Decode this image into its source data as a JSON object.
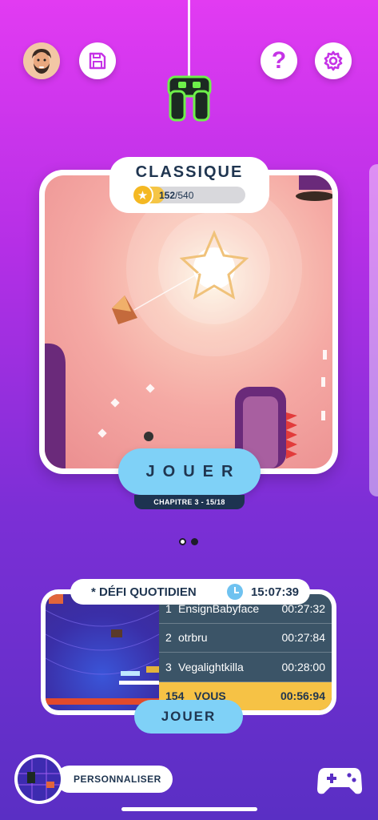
{
  "header": {
    "avatar": "avatar-icon",
    "save_icon": "floppy-disk-icon",
    "help_label": "?",
    "settings_icon": "gear-icon",
    "mascot_icon": "robot-icon"
  },
  "level_card": {
    "title": "CLASSIQUE",
    "stars_collected": "152",
    "stars_total": "/540",
    "progress_fraction": 0.28,
    "play_label": "JOUER",
    "chapter_label": "CHAPITRE 3 - 15/18"
  },
  "pager": {
    "count": 2,
    "active_index": 0
  },
  "daily": {
    "title": "* DÉFI QUOTIDIEN",
    "timer": "15:07:39",
    "leaderboard": [
      {
        "rank": "1",
        "name": "EnsignBabyface",
        "time": "00:27:32"
      },
      {
        "rank": "2",
        "name": "otrbru",
        "time": "00:27:84"
      },
      {
        "rank": "3",
        "name": "Vegalightkilla",
        "time": "00:28:00"
      }
    ],
    "me": {
      "rank": "154",
      "name": "VOUS",
      "time": "00:56:94"
    },
    "play_label": "JOUER"
  },
  "footer": {
    "customize_label": "PERSONNALISER",
    "gamepad_icon": "gamepad-icon"
  },
  "colors": {
    "bg_top": "#e23bf2",
    "bg_bottom": "#5a2fc4",
    "button": "#7fd1f7",
    "navy": "#1f3550",
    "gold": "#f6c245"
  }
}
